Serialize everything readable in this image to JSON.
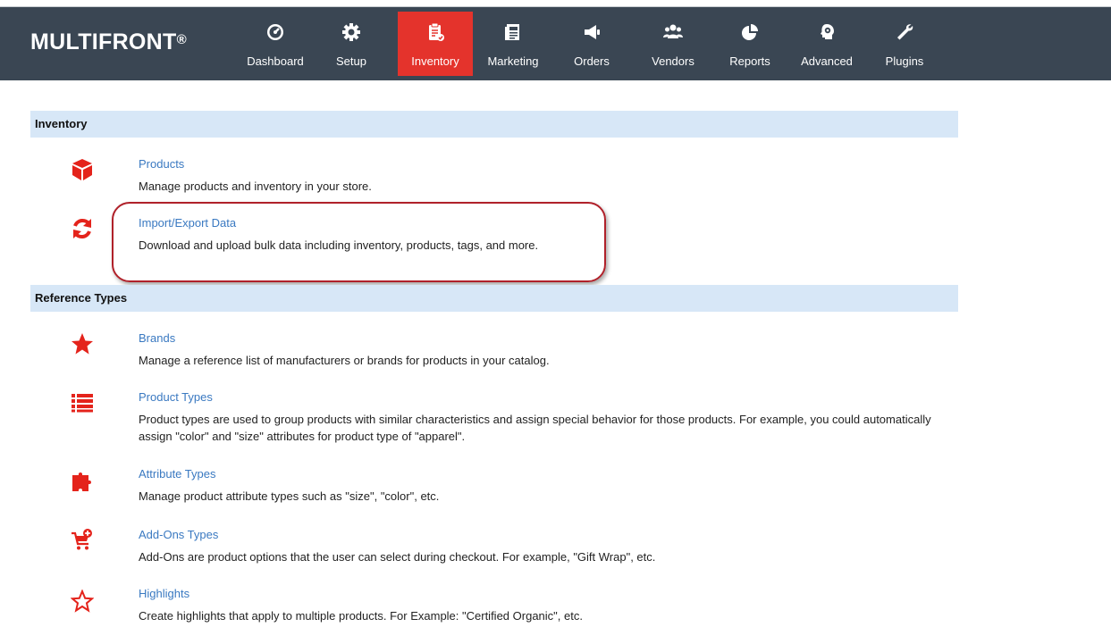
{
  "app": {
    "logo": "MULTIFRONT",
    "logo_mark": "®"
  },
  "nav": {
    "items": [
      {
        "label": "Dashboard",
        "icon": "dashboard-gauge-icon"
      },
      {
        "label": "Setup",
        "icon": "gear-icon"
      },
      {
        "label": "Inventory",
        "icon": "clipboard-check-icon",
        "active": true
      },
      {
        "label": "Marketing",
        "icon": "newspaper-icon"
      },
      {
        "label": "Orders",
        "icon": "megaphone-icon"
      },
      {
        "label": "Vendors",
        "icon": "users-icon"
      },
      {
        "label": "Reports",
        "icon": "pie-chart-icon"
      },
      {
        "label": "Advanced",
        "icon": "head-gear-icon"
      },
      {
        "label": "Plugins",
        "icon": "wrench-icon"
      }
    ]
  },
  "sections": [
    {
      "title": "Inventory",
      "items": [
        {
          "title": "Products",
          "desc": "Manage products and inventory in your store.",
          "icon": "cube-icon"
        },
        {
          "title": "Import/Export Data",
          "desc": "Download and upload bulk data including inventory, products, tags, and more.",
          "icon": "refresh-icon"
        }
      ]
    },
    {
      "title": "Reference Types",
      "items": [
        {
          "title": "Brands",
          "desc": "Manage a reference list of manufacturers or brands for products in your catalog.",
          "icon": "star-icon"
        },
        {
          "title": "Product Types",
          "desc": "Product types are used to group products with similar characteristics and assign special behavior for those products. For example, you could automatically assign \"color\" and \"size\" attributes for product type of \"apparel\".",
          "icon": "list-icon"
        },
        {
          "title": "Attribute Types",
          "desc": "Manage product attribute types such as \"size\", \"color\", etc.",
          "icon": "puzzle-icon"
        },
        {
          "title": "Add-Ons Types",
          "desc": "Add-Ons are product options that the user can select during checkout. For example, \"Gift Wrap\", etc.",
          "icon": "cart-add-icon"
        },
        {
          "title": "Highlights",
          "desc": "Create highlights that apply to multiple products. For Example: \"Certified Organic\", etc.",
          "icon": "star-outline-icon"
        }
      ]
    }
  ],
  "colors": {
    "topbar": "#3a4653",
    "active_tab": "#e4332c",
    "section_header": "#d7e7f7",
    "link": "#3a79c1",
    "icon_red": "#e4231b",
    "annotation": "#b0212a"
  }
}
